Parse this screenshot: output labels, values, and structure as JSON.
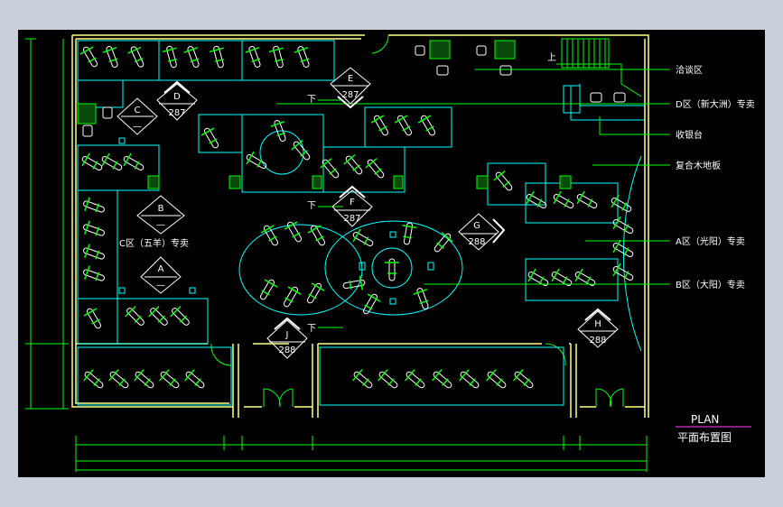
{
  "plan": {
    "title": "PLAN",
    "subtitle": "平面布置图"
  },
  "labels": {
    "negotiation": "洽谈区",
    "zone_d": "D区（新大洲）专卖",
    "cashier": "收银台",
    "floor": "复合木地板",
    "zone_a": "A区（光阳）专卖",
    "zone_b": "B区（大阳）专卖",
    "zone_c": "C区（五羊）专卖",
    "up": "上",
    "down": "下"
  },
  "tags": {
    "A": {
      "letter": "A",
      "num": "—"
    },
    "B": {
      "letter": "B",
      "num": "—"
    },
    "C": {
      "letter": "C",
      "num": "—"
    },
    "D": {
      "letter": "D",
      "num": "287"
    },
    "E": {
      "letter": "E",
      "num": "287"
    },
    "F": {
      "letter": "F",
      "num": "287"
    },
    "G": {
      "letter": "G",
      "num": "288"
    },
    "H": {
      "letter": "H",
      "num": "288"
    },
    "J": {
      "letter": "J",
      "num": "288"
    }
  },
  "colors": {
    "wall": "#ffff80",
    "furniture": "#00ffff",
    "vehicle": "#ffffff",
    "accent": "#00ff00",
    "leader": "#00ff00",
    "dimension": "#00ff00"
  }
}
